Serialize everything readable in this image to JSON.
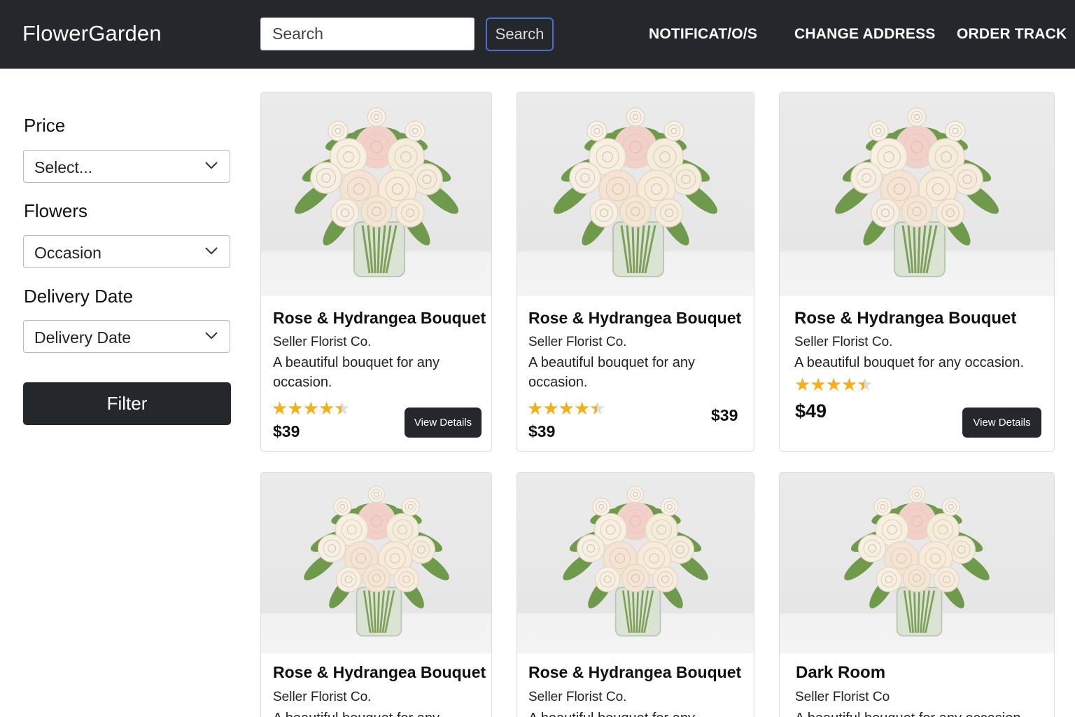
{
  "header": {
    "brand": "FlowerGarden",
    "search_placeholder": "Search",
    "search_button": "Search",
    "nav": [
      "NOTIFICAT/O/S",
      "CHANGE ADDRESS",
      "ORDER TRACK"
    ]
  },
  "sidebar": {
    "price_label": "Price",
    "price_select": "Select...",
    "flowers_label": "Flowers",
    "flowers_select": "Occasion",
    "delivery_label": "Delivery Date",
    "delivery_select": "Delivery Date",
    "filter_button": "Filter"
  },
  "products": [
    {
      "title": "Rose & Hydrangea Bouquet",
      "seller": "Seller Florist Co.",
      "desc_1": "A beautiful bouquet for any",
      "desc_2": "occasion.",
      "rating": 4.5,
      "price": "$39",
      "button": "View Details"
    },
    {
      "title": "Rose & Hydrangea Bouquet",
      "seller": "Seller Florist Co.",
      "desc_1": "A beautiful bouquet for any",
      "desc_2": "occasion.",
      "rating": 4.5,
      "price": "$39",
      "price_right": "$39"
    },
    {
      "title": "Rose & Hydrangea Bouquet",
      "seller": "Seller Florist Co.",
      "desc_1": "A beautiful bouquet for any occasion.",
      "rating": 4.5,
      "price": "$49",
      "button": "View Details"
    },
    {
      "title": "Rose & Hydrangea Bouquet",
      "seller": "Seller Florist Co.",
      "desc_1": "A beautiful bouquet for any"
    },
    {
      "title": "Rose & Hydrangea Bouquet",
      "seller": "Seller Florist Co.",
      "desc_1": "A beautiful bouquet for any"
    },
    {
      "title": "Dark Room",
      "seller": "Seller Florist Co",
      "desc_1": "A beautiful bouquet for any occasion."
    }
  ],
  "icons": {
    "dropdown": "chevron-down-icon",
    "rating": "star-icon",
    "product_image": "flower-vase-image"
  },
  "colors": {
    "navbar": "#24272b",
    "star": "#f2b01e",
    "search_border": "#4a6fd0"
  }
}
